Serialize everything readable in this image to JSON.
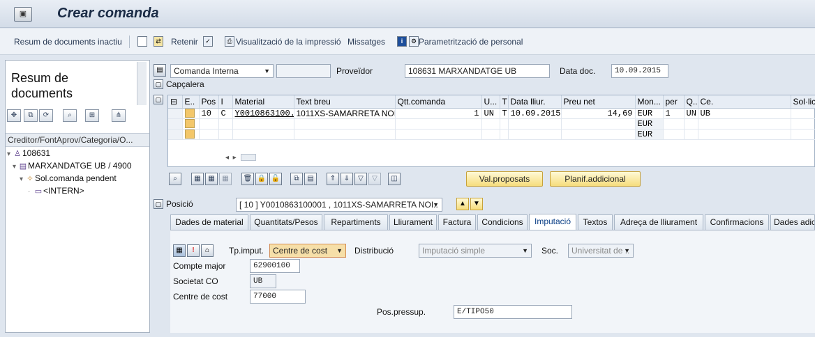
{
  "title": "Crear comanda",
  "toolbar": {
    "summary": "Resum de documents inactiu",
    "hold": "Retenir",
    "print_preview": "Visualització de la impressió",
    "messages": "Missatges",
    "personal_settings": "Parametrització de personal"
  },
  "left": {
    "title": "Resum de documents",
    "header": "Creditor/FontAprov/Categoria/O...",
    "tree": [
      "108631",
      "MARXANDATGE UB / 4900",
      "Sol.comanda pendent",
      "<INTERN>"
    ]
  },
  "header": {
    "doc_type": "Comanda Interna",
    "doc_number": "",
    "vendor_label": "Proveïdor",
    "vendor_value": "108631 MARXANDATGE UB",
    "date_label": "Data doc.",
    "date_value": "10.09.2015",
    "header_toggle": "Capçalera"
  },
  "grid": {
    "columns": [
      "E..",
      "Pos",
      "I",
      "Material",
      "Text breu",
      "Qtt.comanda",
      "U...",
      "T",
      "Data lliur.",
      "Preu net",
      "Mon...",
      "per",
      "Q...",
      "Ce.",
      "Sol·lic"
    ],
    "rows": [
      {
        "pos": "10",
        "i": "C",
        "material": "Y0010863100..",
        "text": "1011XS-SAMARRETA NOI ..",
        "qty": "1",
        "unit": "UN",
        "t": "T",
        "date": "10.09.2015",
        "price": "14,69",
        "currency": "EUR",
        "per": "1",
        "q": "UN",
        "ce": "UB"
      },
      {
        "pos": "",
        "i": "",
        "material": "",
        "text": "",
        "qty": "",
        "unit": "",
        "t": "",
        "date": "",
        "price": "",
        "currency": "EUR",
        "per": "",
        "q": "",
        "ce": ""
      },
      {
        "pos": "",
        "i": "",
        "material": "",
        "text": "",
        "qty": "",
        "unit": "",
        "t": "",
        "date": "",
        "price": "",
        "currency": "EUR",
        "per": "",
        "q": "",
        "ce": ""
      }
    ],
    "buttons": {
      "proposals": "Val.proposats",
      "planning": "Planif.addicional"
    }
  },
  "item": {
    "label": "Posició",
    "value": "[ 10 ] Y0010863100001 , 1011XS-SAMARRETA NOI.."
  },
  "tabs": [
    "Dades de material",
    "Quantitats/Pesos",
    "Repartiments",
    "Lliurament",
    "Factura",
    "Condicions",
    "Imputació",
    "Textos",
    "Adreça de lliurament",
    "Confirmacions",
    "Dades adici"
  ],
  "active_tab": "Imputació",
  "accounting": {
    "tp_label": "Tp.imput.",
    "tp_value": "Centre de cost",
    "dist_label": "Distribució",
    "dist_value": "Imputació simple",
    "soc_label": "Soc.",
    "soc_value": "Universitat de ..",
    "gl_label": "Compte major",
    "gl_value": "62900100",
    "co_label": "Societat CO",
    "co_value": "UB",
    "cc_label": "Centre de cost",
    "cc_value": "77000",
    "budget_label": "Pos.pressup.",
    "budget_value": "E/TIPO50"
  }
}
